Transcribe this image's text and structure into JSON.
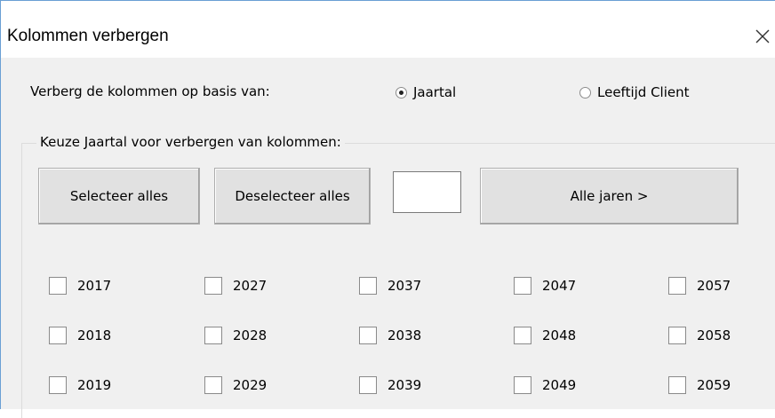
{
  "window": {
    "title": "Kolommen verbergen",
    "close_glyph": "×"
  },
  "mode": {
    "label": "Verberg de kolommen op basis van:",
    "options": [
      {
        "label": "Jaartal",
        "selected": true
      },
      {
        "label": "Leeftijd Client",
        "selected": false
      }
    ]
  },
  "frame": {
    "legend": "Keuze Jaartal voor verbergen van kolommen:",
    "select_all_label": "Selecteer alles",
    "deselect_all_label": "Deselecteer alles",
    "year_input_value": "",
    "all_years_label": "Alle jaren >",
    "years": [
      [
        "2017",
        "2027",
        "2037",
        "2047",
        "2057"
      ],
      [
        "2018",
        "2028",
        "2038",
        "2048",
        "2058"
      ],
      [
        "2019",
        "2029",
        "2039",
        "2049",
        "2059"
      ]
    ]
  },
  "colors": {
    "dialog_bg": "#f0f0f0",
    "titlebar_bg": "#ffffff",
    "window_border": "#6a9fd4"
  }
}
